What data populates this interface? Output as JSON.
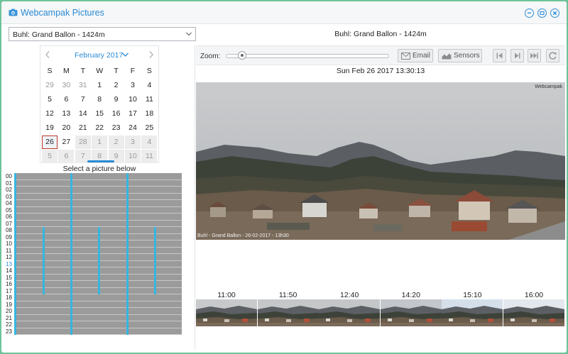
{
  "window": {
    "title": "Webcampak Pictures",
    "icon": "camera-icon"
  },
  "window_buttons": [
    "minimize-icon",
    "maximize-icon",
    "close-icon"
  ],
  "source_select": {
    "value": "Buhl: Grand Ballon - 1424m"
  },
  "calendar": {
    "month_label": "February 2017",
    "weekdays": [
      "S",
      "M",
      "T",
      "W",
      "T",
      "F",
      "S"
    ],
    "weeks": [
      [
        "29",
        "30",
        "31",
        "1",
        "2",
        "3",
        "4"
      ],
      [
        "5",
        "6",
        "7",
        "8",
        "9",
        "10",
        "11"
      ],
      [
        "12",
        "13",
        "14",
        "15",
        "16",
        "17",
        "18"
      ],
      [
        "19",
        "20",
        "21",
        "22",
        "23",
        "24",
        "25"
      ],
      [
        "26",
        "27",
        "28",
        "1",
        "2",
        "3",
        "4"
      ],
      [
        "5",
        "6",
        "7",
        "8",
        "9",
        "10",
        "11"
      ]
    ],
    "selected_day": "26"
  },
  "timeline": {
    "caption": "Select a picture below",
    "hours": [
      "00",
      "01",
      "02",
      "03",
      "04",
      "05",
      "06",
      "07",
      "08",
      "09",
      "10",
      "11",
      "12",
      "13",
      "14",
      "15",
      "16",
      "17",
      "18",
      "19",
      "20",
      "21",
      "22",
      "23"
    ],
    "selected_hour": "13"
  },
  "viewer": {
    "camera_title": "Buhl: Grand Ballon - 1424m",
    "zoom_label": "Zoom:",
    "zoom_level": 0.1,
    "email_label": "Email",
    "sensors_label": "Sensors",
    "timestamp": "Sun Feb 26 2017 13:30:13",
    "photo_caption": "Buhl - Grand Ballon - 26-02-2017 - 13h30",
    "photo_logo": "Webcampak"
  },
  "thumbnails": {
    "times": [
      "11:00",
      "11:50",
      "12:40",
      "14:20",
      "15:10",
      "16:00"
    ]
  },
  "colors": {
    "accent": "#2a8ad4",
    "timeline_mark": "#35b6e0",
    "selected_border": "#c0392b",
    "frame": "#6dc49a"
  }
}
